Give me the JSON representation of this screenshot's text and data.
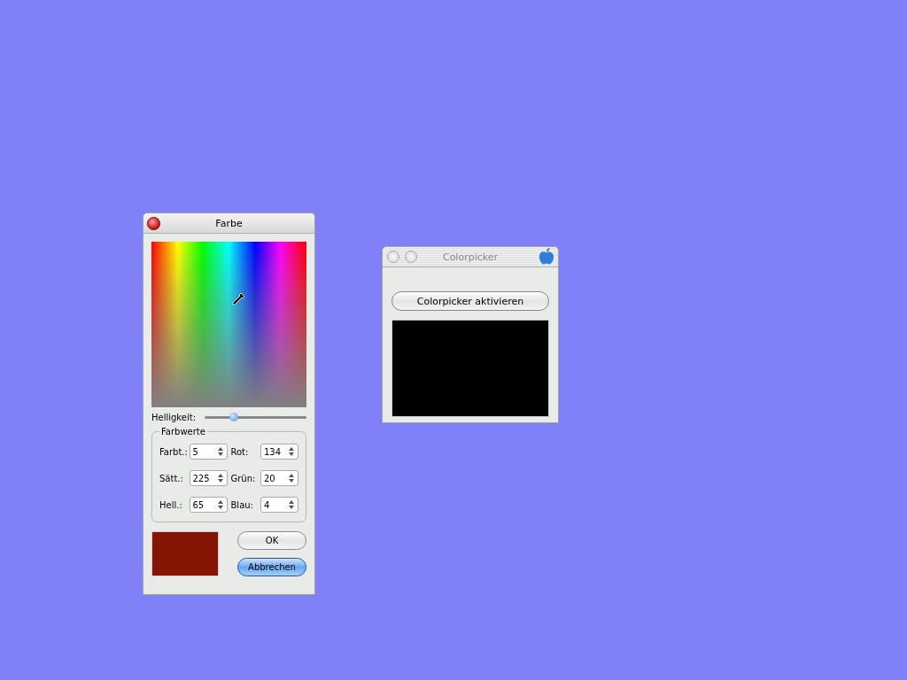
{
  "color_window": {
    "title": "Farbe",
    "brightness": {
      "label": "Helligkeit:",
      "level": 0.29
    },
    "group": {
      "title": "Farbwerte",
      "fields": [
        {
          "label": "Farbt.:",
          "value": "5"
        },
        {
          "label": "Rot:",
          "value": "134"
        },
        {
          "label": "Sätt.:",
          "value": "225"
        },
        {
          "label": "Grün:",
          "value": "20"
        },
        {
          "label": "Hell.:",
          "value": "65"
        },
        {
          "label": "Blau:",
          "value": "4"
        }
      ]
    },
    "preview": {
      "color": "#861404"
    },
    "buttons": [
      {
        "label": "OK",
        "default": false
      },
      {
        "label": "Abbrechen",
        "default": true
      }
    ]
  },
  "picker_window": {
    "title": "Colorpicker",
    "button": "Colorpicker aktivieren",
    "preview": {
      "color": "#000000"
    }
  }
}
